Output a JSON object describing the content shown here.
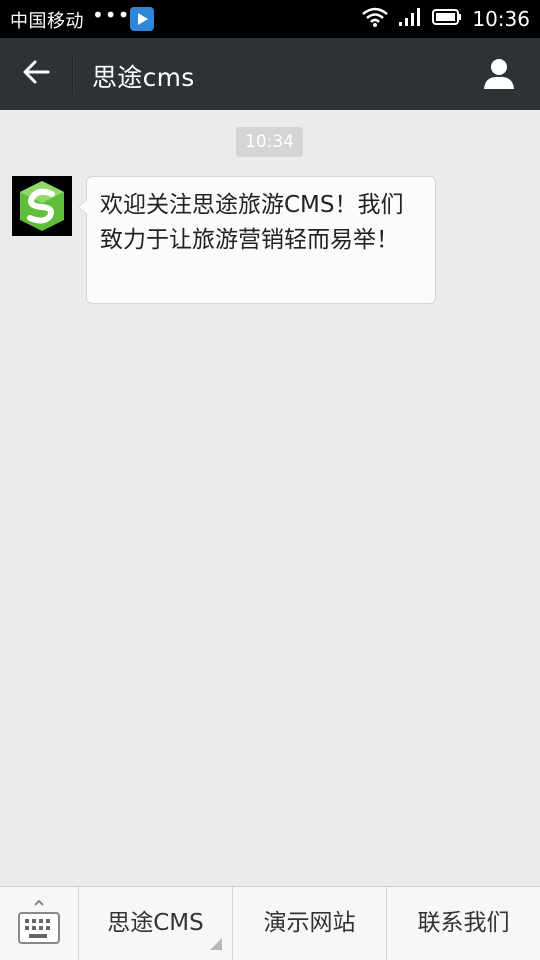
{
  "statusbar": {
    "carrier": "中国移动",
    "dots": "•••",
    "time": "10:36",
    "icons": [
      "play-app-icon",
      "wifi-icon",
      "signal-icon",
      "battery-icon"
    ]
  },
  "header": {
    "title": "思途cms",
    "icons": [
      "back-arrow-icon",
      "profile-icon"
    ]
  },
  "chat": {
    "timestamp": "10:34",
    "messages": [
      {
        "text": "欢迎关注思途旅游CMS！我们致力于让旅游营销轻而易举！",
        "avatar_icon": "siteu-logo-icon"
      }
    ]
  },
  "bottom_menu": {
    "keyboard_icon": "keyboard-icon",
    "items": [
      {
        "label": "思途CMS",
        "has_submenu": true
      },
      {
        "label": "演示网站",
        "has_submenu": false
      },
      {
        "label": "联系我们",
        "has_submenu": false
      }
    ]
  },
  "colors": {
    "header_bg": "#2e3237",
    "chat_bg": "#ebebeb",
    "bubble_bg": "#fbfbfb",
    "logo_green": "#5fbf3a"
  }
}
